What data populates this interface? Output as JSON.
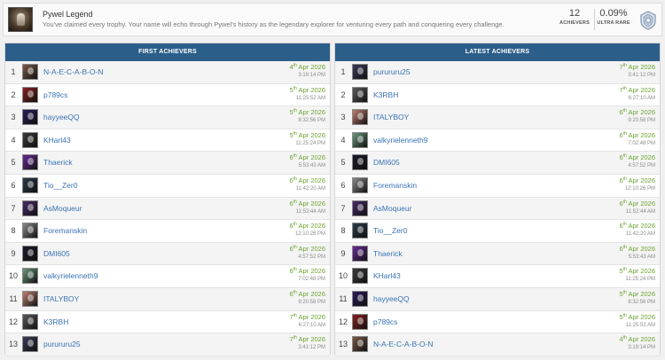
{
  "trophy": {
    "title": "Pywel Legend",
    "description": "You've claimed every trophy. Your name will echo through Pywel's history as the legendary explorer for venturing every path and conquering every challenge.",
    "achievers_value": "12",
    "achievers_label": "ACHIEVERS",
    "rarity_value": "0.09%",
    "rarity_label": "ULTRA RARE",
    "icon": "platinum-trophy-icon"
  },
  "first": {
    "heading": "FIRST ACHIEVERS",
    "rows": [
      {
        "rank": "1",
        "name": "N-A-E-C-A-B-O-N",
        "day": "4",
        "suffix": "th",
        "rest": " Apr 2026",
        "time": "3:19:14 PM",
        "avatar_color": "#7a5a48"
      },
      {
        "rank": "2",
        "name": "p789cs",
        "day": "5",
        "suffix": "th",
        "rest": " Apr 2026",
        "time": "11:25:52 AM",
        "avatar_color": "#8a2020"
      },
      {
        "rank": "3",
        "name": "hayyeeQQ",
        "day": "5",
        "suffix": "th",
        "rest": " Apr 2026",
        "time": "8:32:56 PM",
        "avatar_color": "#2a1a5a"
      },
      {
        "rank": "4",
        "name": "KHarl43",
        "day": "5",
        "suffix": "th",
        "rest": " Apr 2026",
        "time": "11:25:24 PM",
        "avatar_color": "#3a3a3a"
      },
      {
        "rank": "5",
        "name": "Thaerick",
        "day": "6",
        "suffix": "th",
        "rest": " Apr 2026",
        "time": "5:53:43 AM",
        "avatar_color": "#6a2a9a"
      },
      {
        "rank": "6",
        "name": "Tio__Zer0",
        "day": "6",
        "suffix": "th",
        "rest": " Apr 2026",
        "time": "11:42:20 AM",
        "avatar_color": "#2a3a4a"
      },
      {
        "rank": "7",
        "name": "AsMoqueur",
        "day": "6",
        "suffix": "th",
        "rest": " Apr 2026",
        "time": "11:52:44 AM",
        "avatar_color": "#4a2a6a"
      },
      {
        "rank": "8",
        "name": "Foremanskin",
        "day": "6",
        "suffix": "th",
        "rest": " Apr 2026",
        "time": "12:10:26 PM",
        "avatar_color": "#8a8a8a"
      },
      {
        "rank": "9",
        "name": "DMI605",
        "day": "6",
        "suffix": "th",
        "rest": " Apr 2026",
        "time": "4:57:52 PM",
        "avatar_color": "#1a1a2a"
      },
      {
        "rank": "10",
        "name": "valkyrielenneth9",
        "day": "6",
        "suffix": "th",
        "rest": " Apr 2026",
        "time": "7:02:48 PM",
        "avatar_color": "#6a9a7a"
      },
      {
        "rank": "11",
        "name": "ITALYBOY",
        "day": "6",
        "suffix": "th",
        "rest": " Apr 2026",
        "time": "9:20:58 PM",
        "avatar_color": "#c08070"
      },
      {
        "rank": "12",
        "name": "K3RBH",
        "day": "7",
        "suffix": "th",
        "rest": " Apr 2026",
        "time": "6:27:10 AM",
        "avatar_color": "#5a5a5a"
      },
      {
        "rank": "13",
        "name": "purururu25",
        "day": "7",
        "suffix": "th",
        "rest": " Apr 2026",
        "time": "3:41:12 PM",
        "avatar_color": "#3a3a5a"
      }
    ]
  },
  "latest": {
    "heading": "LATEST ACHIEVERS",
    "rows": [
      {
        "rank": "1",
        "name": "purururu25",
        "day": "7",
        "suffix": "th",
        "rest": " Apr 2026",
        "time": "3:41:12 PM",
        "avatar_color": "#3a3a5a"
      },
      {
        "rank": "2",
        "name": "K3RBH",
        "day": "7",
        "suffix": "th",
        "rest": " Apr 2026",
        "time": "6:27:10 AM",
        "avatar_color": "#5a5a5a"
      },
      {
        "rank": "3",
        "name": "ITALYBOY",
        "day": "6",
        "suffix": "th",
        "rest": " Apr 2026",
        "time": "9:20:58 PM",
        "avatar_color": "#c08070"
      },
      {
        "rank": "4",
        "name": "valkyrielenneth9",
        "day": "6",
        "suffix": "th",
        "rest": " Apr 2026",
        "time": "7:02:48 PM",
        "avatar_color": "#6a9a7a"
      },
      {
        "rank": "5",
        "name": "DMI605",
        "day": "6",
        "suffix": "th",
        "rest": " Apr 2026",
        "time": "4:57:52 PM",
        "avatar_color": "#1a1a2a"
      },
      {
        "rank": "6",
        "name": "Foremanskin",
        "day": "6",
        "suffix": "th",
        "rest": " Apr 2026",
        "time": "12:10:26 PM",
        "avatar_color": "#8a8a8a"
      },
      {
        "rank": "7",
        "name": "AsMoqueur",
        "day": "6",
        "suffix": "th",
        "rest": " Apr 2026",
        "time": "11:52:44 AM",
        "avatar_color": "#4a2a6a"
      },
      {
        "rank": "8",
        "name": "Tio__Zer0",
        "day": "6",
        "suffix": "th",
        "rest": " Apr 2026",
        "time": "11:42:20 AM",
        "avatar_color": "#2a3a4a"
      },
      {
        "rank": "9",
        "name": "Thaerick",
        "day": "6",
        "suffix": "th",
        "rest": " Apr 2026",
        "time": "5:53:43 AM",
        "avatar_color": "#6a2a9a"
      },
      {
        "rank": "10",
        "name": "KHarl43",
        "day": "5",
        "suffix": "th",
        "rest": " Apr 2026",
        "time": "11:25:24 PM",
        "avatar_color": "#3a3a3a"
      },
      {
        "rank": "11",
        "name": "hayyeeQQ",
        "day": "5",
        "suffix": "th",
        "rest": " Apr 2026",
        "time": "8:32:56 PM",
        "avatar_color": "#2a1a5a"
      },
      {
        "rank": "12",
        "name": "p789cs",
        "day": "5",
        "suffix": "th",
        "rest": " Apr 2026",
        "time": "11:25:52 AM",
        "avatar_color": "#8a2020"
      },
      {
        "rank": "13",
        "name": "N-A-E-C-A-B-O-N",
        "day": "4",
        "suffix": "th",
        "rest": " Apr 2026",
        "time": "3:19:14 PM",
        "avatar_color": "#7a5a48"
      }
    ]
  }
}
